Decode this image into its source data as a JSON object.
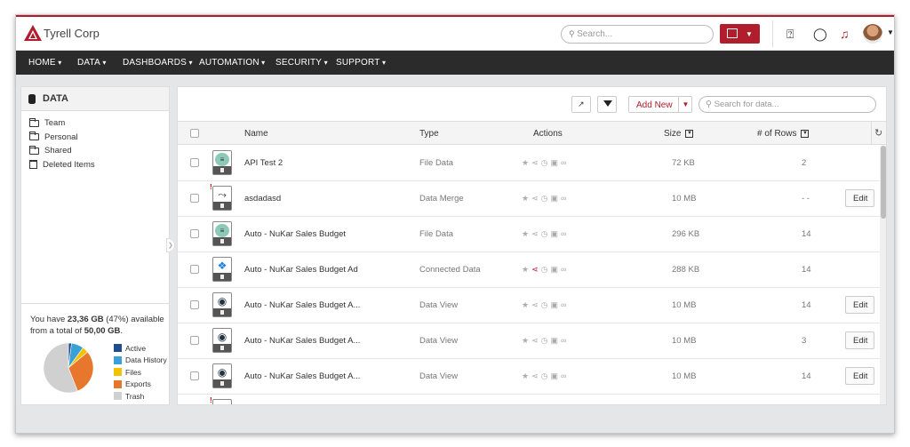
{
  "app": {
    "brand": "Tyrell Corp",
    "accent": "#b01e2e"
  },
  "top": {
    "search_placeholder": "Search..."
  },
  "nav": [
    "HOME",
    "DATA",
    "DASHBOARDS",
    "AUTOMATION",
    "SECURITY",
    "SUPPORT"
  ],
  "sidebar": {
    "title": "DATA",
    "items": [
      "Team",
      "Personal",
      "Shared",
      "Deleted Items"
    ],
    "storage_pre": "You have ",
    "storage_used": "23,36 GB",
    "storage_mid": " (47%) available from a total of ",
    "storage_total": "50,00 GB",
    "storage_end": ".",
    "legend": [
      {
        "label": "Active",
        "color": "#1f4e8c"
      },
      {
        "label": "Data History",
        "color": "#3aa0d8"
      },
      {
        "label": "Files",
        "color": "#f2c300"
      },
      {
        "label": "Exports",
        "color": "#e8772e"
      },
      {
        "label": "Trash",
        "color": "#d0d0d0"
      }
    ],
    "pie_fractions": [
      0.02,
      0.08,
      0.04,
      0.3,
      0.56
    ]
  },
  "toolbar": {
    "add_new": "Add New",
    "search_placeholder": "Search for data..."
  },
  "table": {
    "headers": {
      "name": "Name",
      "type": "Type",
      "actions": "Actions",
      "size": "Size",
      "rows": "# of Rows"
    },
    "rows": [
      {
        "name": "API Test 2",
        "type": "File Data",
        "size": "72 KB",
        "rows": "2",
        "icon": "file-data-icon",
        "edit": "",
        "alert": false,
        "share_hl": false
      },
      {
        "name": "asdadasd",
        "type": "Data Merge",
        "size": "10 MB",
        "rows": "- -",
        "icon": "data-merge-icon",
        "edit": "Edit",
        "alert": true,
        "share_hl": false
      },
      {
        "name": "Auto - NuKar Sales Budget",
        "type": "File Data",
        "size": "296 KB",
        "rows": "14",
        "icon": "file-data-icon",
        "edit": "",
        "alert": false,
        "share_hl": false
      },
      {
        "name": "Auto - NuKar Sales Budget Ad",
        "type": "Connected Data",
        "size": "288 KB",
        "rows": "14",
        "icon": "dropbox-icon",
        "edit": "",
        "alert": false,
        "share_hl": true
      },
      {
        "name": "Auto - NuKar Sales Budget A...",
        "type": "Data View",
        "size": "10 MB",
        "rows": "14",
        "icon": "data-view-icon",
        "edit": "Edit",
        "alert": false,
        "share_hl": false
      },
      {
        "name": "Auto - NuKar Sales Budget A...",
        "type": "Data View",
        "size": "10 MB",
        "rows": "3",
        "icon": "data-view-icon",
        "edit": "Edit",
        "alert": false,
        "share_hl": false
      },
      {
        "name": "Auto - NuKar Sales Budget A...",
        "type": "Data View",
        "size": "10 MB",
        "rows": "14",
        "icon": "data-view-icon",
        "edit": "Edit",
        "alert": false,
        "share_hl": false
      },
      {
        "name": "",
        "type": "",
        "size": "",
        "rows": "",
        "icon": "data-merge-icon",
        "edit": "",
        "alert": true,
        "share_hl": false
      }
    ]
  }
}
